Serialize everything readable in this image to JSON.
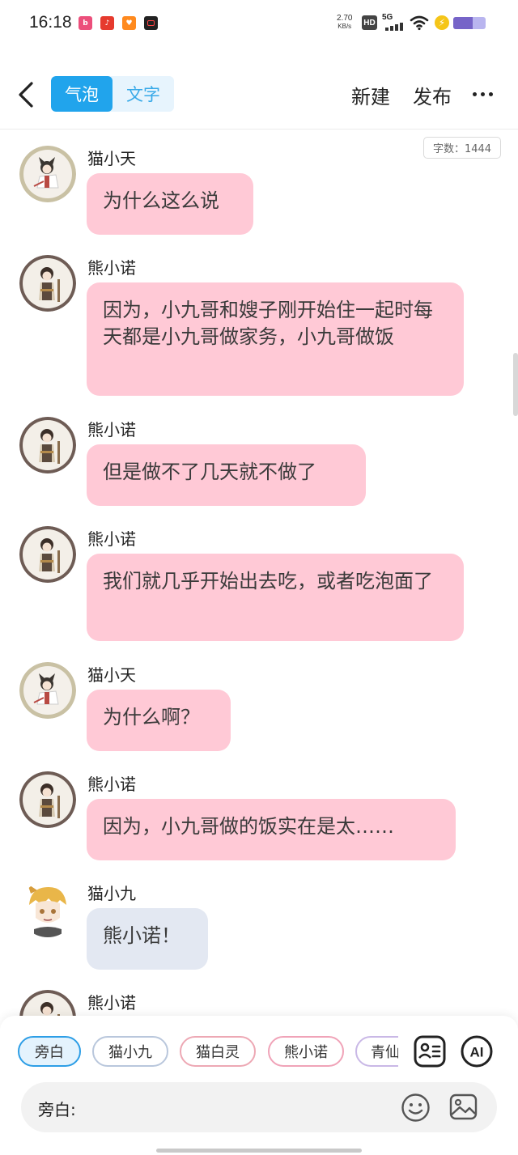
{
  "status_bar": {
    "time": "16:18",
    "apps": [
      "bilibili-app-icon",
      "listen-app-icon",
      "red-app-icon",
      "camera-app-icon"
    ],
    "net_speed_value": "2.70",
    "net_speed_unit": "KB/s",
    "hd": "HD",
    "network": "5G",
    "battery_level": 0.6
  },
  "header": {
    "tab_bubble": "气泡",
    "tab_text": "文字",
    "new_label": "新建",
    "publish_label": "发布"
  },
  "chat": {
    "word_count": "字数：1444",
    "messages": [
      {
        "name": "猫小天",
        "text": "为什么这么说",
        "avatar": "mao-xiaotian"
      },
      {
        "name": "熊小诺",
        "text": "因为，小九哥和嫂子刚开始住一起时每天都是小九哥做家务，小九哥做饭",
        "avatar": "xiong-xiaonuo"
      },
      {
        "name": "熊小诺",
        "text": "但是做不了几天就不做了",
        "avatar": "xiong-xiaonuo"
      },
      {
        "name": "熊小诺",
        "text": "我们就几乎开始出去吃，或者吃泡面了",
        "avatar": "xiong-xiaonuo"
      },
      {
        "name": "猫小天",
        "text": "为什么啊？",
        "avatar": "mao-xiaotian"
      },
      {
        "name": "熊小诺",
        "text": "因为，小九哥做的饭实在是太……",
        "avatar": "xiong-xiaonuo"
      },
      {
        "name": "猫小九",
        "text": "熊小诺！",
        "avatar": "mao-xiaojiu"
      },
      {
        "name": "熊小诺",
        "text": "",
        "avatar": "xiong-xiaonuo"
      }
    ]
  },
  "bottom": {
    "chips": [
      "旁白",
      "猫小九",
      "猫白灵",
      "熊小诺",
      "青仙"
    ],
    "input_label": "旁白:",
    "ai_label": "AI"
  },
  "colors": {
    "accent": "#21a4ec",
    "bubble_pink": "#ffc9d6",
    "bubble_blue": "#e3e8f2"
  }
}
